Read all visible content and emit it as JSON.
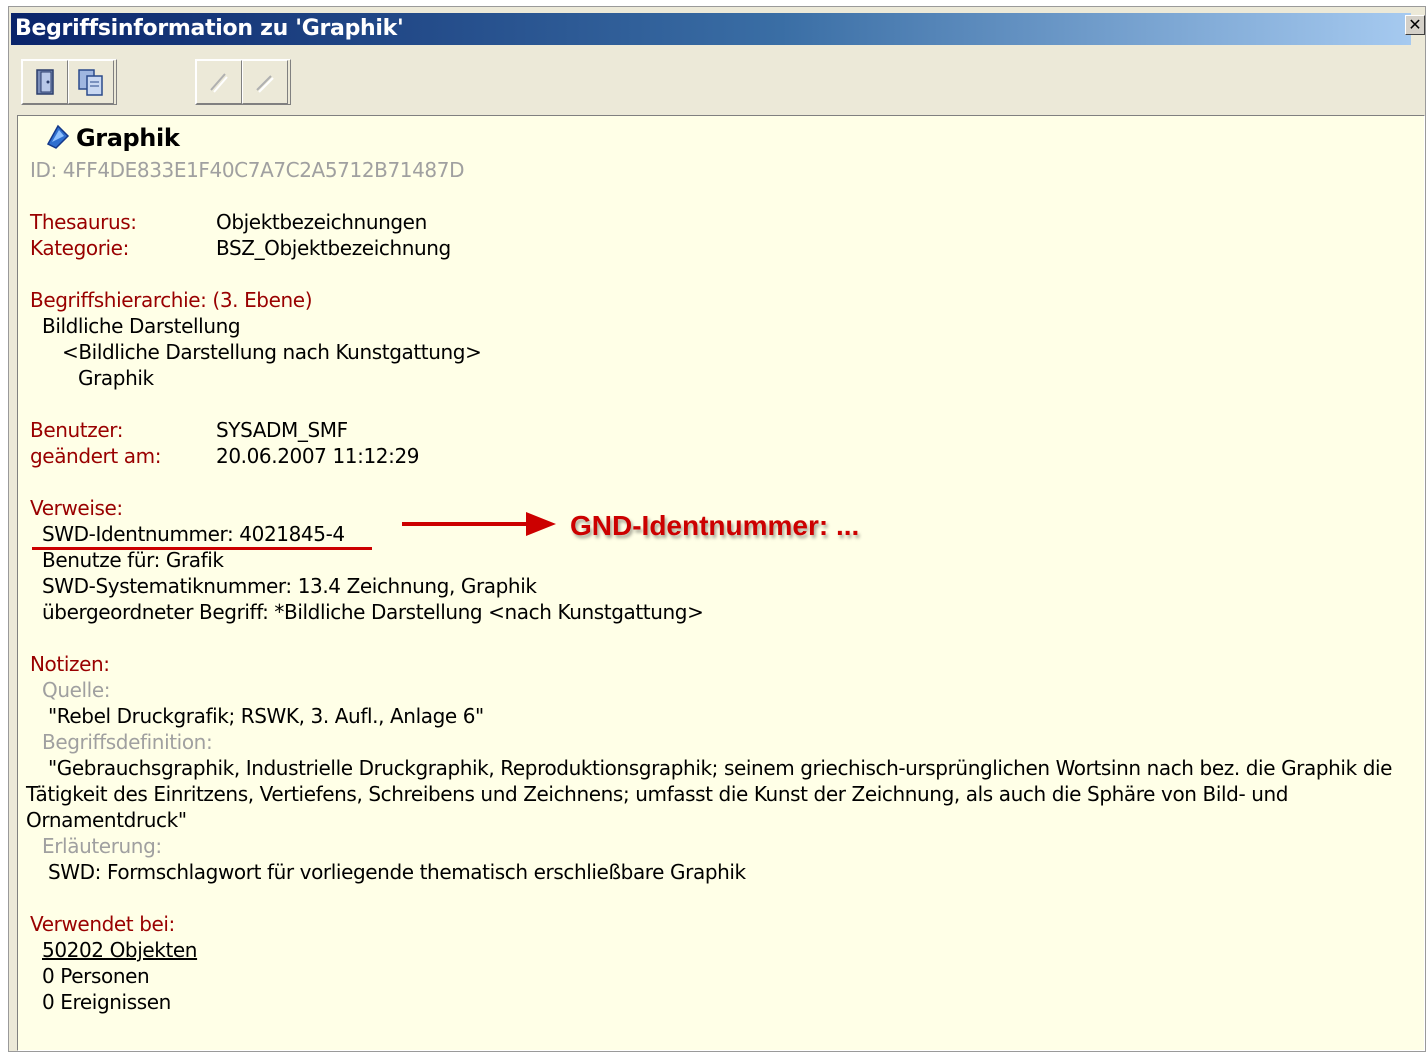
{
  "window": {
    "title": "Begriffsinformation zu 'Graphik'",
    "close_glyph": "✕"
  },
  "toolbar": {
    "buttons": [
      "door-icon",
      "copy-icon",
      "edit-icon",
      "edit-disabled-icon"
    ]
  },
  "term": {
    "name": "Graphik",
    "id_line": "ID: 4FF4DE833E1F40C7A7C2A5712B71487D"
  },
  "meta": {
    "thesaurus_label": "Thesaurus:",
    "thesaurus_value": "Objektbezeichnungen",
    "category_label": "Kategorie:",
    "category_value": "BSZ_Objektbezeichnung"
  },
  "hierarchy": {
    "label": "Begriffshierarchie: (3. Ebene)",
    "level1": "Bildliche Darstellung",
    "level2": "<Bildliche Darstellung nach Kunstgattung>",
    "level3": "Graphik"
  },
  "user": {
    "user_label": "Benutzer:",
    "user_value": "SYSADM_SMF",
    "changed_label": "geändert am:",
    "changed_value": "20.06.2007 11:12:29"
  },
  "references": {
    "label": "Verweise:",
    "swd_id": "SWD-Identnummer: 4021845-4",
    "use_for": "Benutze für: Grafik",
    "systematic": "SWD-Systematiknummer: 13.4 Zeichnung, Graphik",
    "broader": "übergeordneter Begriff: *Bildliche Darstellung <nach Kunstgattung>"
  },
  "notes": {
    "label": "Notizen:",
    "source_label": "Quelle:",
    "source_value": "\"Rebel Druckgrafik; RSWK, 3. Aufl., Anlage 6\"",
    "definition_label": "Begriffsdefinition:",
    "definition_line1": "\"Gebrauchsgraphik, Industrielle Druckgraphik, Reproduktionsgraphik; seinem griechisch-ursprünglichen Wortsinn nach bez. die Graphik die",
    "definition_line2": "Tätigkeit des Einritzens, Vertiefens, Schreibens und Zeichnens; umfasst die Kunst der Zeichnung, als auch die Sphäre von Bild- und",
    "definition_line3": "Ornamentdruck\"",
    "explanation_label": "Erläuterung:",
    "explanation_value": "SWD: Formschlagwort für vorliegende thematisch erschließbare Graphik"
  },
  "usage": {
    "label": "Verwendet bei:",
    "objects_link": "50202 Objekten",
    "persons": "0 Personen",
    "events": "0 Ereignissen"
  },
  "annotation": {
    "text": "GND-Identnummer: ...",
    "color": "#cc0000"
  }
}
